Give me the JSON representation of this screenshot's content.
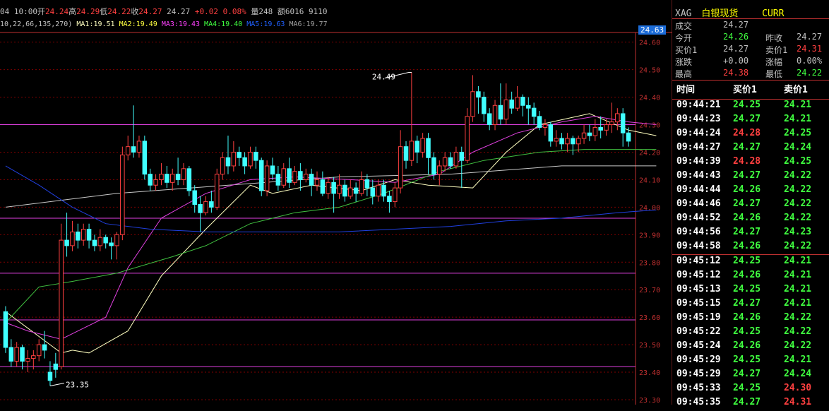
{
  "header": {
    "date_time": "04 10:00",
    "open_label": "开",
    "open": "24.24",
    "high_label": "高",
    "high": "24.29",
    "low_label": "低",
    "low": "24.22",
    "close_label": "收",
    "close": "24.27",
    "close2": "24.27",
    "change": "+0.02",
    "change_pct": "0.08%",
    "vol_label": "量",
    "vol": "248",
    "amt_label": "额",
    "amt": "6016 9110"
  },
  "ma_bar": {
    "params": "10,22,66,135,270)",
    "ma1": "MA1:19.51",
    "ma2": "MA2:19.49",
    "ma3": "MA3:19.43",
    "ma4": "MA4:19.40",
    "ma5": "MA5:19.63",
    "ma6": "MA6:19.77"
  },
  "current_price_tag": "24.63",
  "annotations": {
    "high_label": "24.49",
    "low_label": "23.35"
  },
  "panel": {
    "code": "XAG",
    "name": "白银现货",
    "tag": "CURR",
    "rows": [
      {
        "l1": "成交",
        "v1": "24.27",
        "l2": "",
        "v2": ""
      },
      {
        "l1": "今开",
        "v1": "24.26",
        "l2": "昨收",
        "v2": "24.27"
      },
      {
        "l1": "买价1",
        "v1": "24.27",
        "l2": "卖价1",
        "v2": "24.31"
      },
      {
        "l1": "涨跌",
        "v1": "+0.00",
        "l2": "涨幅",
        "v2": "0.00%"
      },
      {
        "l1": "最高",
        "v1": "24.38",
        "l2": "最低",
        "v2": "24.22"
      }
    ],
    "quote_headers": [
      "时间",
      "买价1",
      "卖价1"
    ],
    "quotes": [
      [
        "09:44:21",
        "24.25",
        "24.21"
      ],
      [
        "09:44:23",
        "24.27",
        "24.21"
      ],
      [
        "09:44:24",
        "24.28",
        "24.25"
      ],
      [
        "09:44:27",
        "24.27",
        "24.24"
      ],
      [
        "09:44:39",
        "24.28",
        "24.25"
      ],
      [
        "09:44:43",
        "24.27",
        "24.22"
      ],
      [
        "09:44:44",
        "24.26",
        "24.22"
      ],
      [
        "09:44:46",
        "24.27",
        "24.22"
      ],
      [
        "09:44:52",
        "24.26",
        "24.22"
      ],
      [
        "09:44:56",
        "24.27",
        "24.23"
      ],
      [
        "09:44:58",
        "24.26",
        "24.22"
      ],
      [
        "09:45:12",
        "24.25",
        "24.21"
      ],
      [
        "09:45:12",
        "24.26",
        "24.21"
      ],
      [
        "09:45:13",
        "24.25",
        "24.21"
      ],
      [
        "09:45:15",
        "24.27",
        "24.21"
      ],
      [
        "09:45:19",
        "24.26",
        "24.22"
      ],
      [
        "09:45:22",
        "24.25",
        "24.22"
      ],
      [
        "09:45:24",
        "24.26",
        "24.22"
      ],
      [
        "09:45:29",
        "24.25",
        "24.21"
      ],
      [
        "09:45:29",
        "24.27",
        "24.24"
      ],
      [
        "09:45:33",
        "24.25",
        "24.30"
      ],
      [
        "09:45:35",
        "24.27",
        "24.31"
      ]
    ],
    "quote_colors": [
      [
        "g",
        "g"
      ],
      [
        "g",
        "g"
      ],
      [
        "r",
        "g"
      ],
      [
        "g",
        "g"
      ],
      [
        "r",
        "g"
      ],
      [
        "g",
        "g"
      ],
      [
        "g",
        "g"
      ],
      [
        "g",
        "g"
      ],
      [
        "g",
        "g"
      ],
      [
        "g",
        "g"
      ],
      [
        "g",
        "g"
      ],
      [
        "g",
        "g"
      ],
      [
        "g",
        "g"
      ],
      [
        "g",
        "g"
      ],
      [
        "g",
        "g"
      ],
      [
        "g",
        "g"
      ],
      [
        "g",
        "g"
      ],
      [
        "g",
        "g"
      ],
      [
        "g",
        "g"
      ],
      [
        "g",
        "g"
      ],
      [
        "g",
        "r"
      ],
      [
        "g",
        "r"
      ]
    ]
  },
  "chart_data": {
    "type": "candlestick",
    "ylim": [
      23.3,
      24.63
    ],
    "y_ticks": [
      "24.60",
      "24.50",
      "24.40",
      "24.30",
      "24.20",
      "24.10",
      "24.00",
      "23.90",
      "23.80",
      "23.70",
      "23.60",
      "23.50",
      "23.40",
      "23.30"
    ],
    "hlines": [
      24.3,
      23.96,
      23.76,
      23.59,
      23.42
    ],
    "candles": [
      [
        23.62,
        23.49,
        23.64,
        23.47
      ],
      [
        23.49,
        23.44,
        23.52,
        23.42
      ],
      [
        23.44,
        23.49,
        23.51,
        23.42
      ],
      [
        23.49,
        23.44,
        23.5,
        23.41
      ],
      [
        23.44,
        23.45,
        23.48,
        23.4
      ],
      [
        23.45,
        23.46,
        23.48,
        23.41
      ],
      [
        23.46,
        23.5,
        23.52,
        23.44
      ],
      [
        23.5,
        23.48,
        23.55,
        23.45
      ],
      [
        23.4,
        23.37,
        23.44,
        23.35
      ],
      [
        23.43,
        23.41,
        23.47,
        23.38
      ],
      [
        23.42,
        23.88,
        23.94,
        23.41
      ],
      [
        23.88,
        23.86,
        23.98,
        23.82
      ],
      [
        23.86,
        23.91,
        23.95,
        23.84
      ],
      [
        23.91,
        23.88,
        23.94,
        23.85
      ],
      [
        23.88,
        23.92,
        23.94,
        23.86
      ],
      [
        23.92,
        23.88,
        23.94,
        23.85
      ],
      [
        23.88,
        23.86,
        23.9,
        23.84
      ],
      [
        23.86,
        23.89,
        23.92,
        23.84
      ],
      [
        23.89,
        23.87,
        23.9,
        23.85
      ],
      [
        23.87,
        23.86,
        23.89,
        23.81
      ],
      [
        23.86,
        23.9,
        23.91,
        23.81
      ],
      [
        23.9,
        24.19,
        24.22,
        23.88
      ],
      [
        24.19,
        24.22,
        24.26,
        24.17
      ],
      [
        24.22,
        24.2,
        24.37,
        24.18
      ],
      [
        24.2,
        24.24,
        24.26,
        24.18
      ],
      [
        24.24,
        24.12,
        24.26,
        24.1
      ],
      [
        24.12,
        24.08,
        24.14,
        24.06
      ],
      [
        24.08,
        24.1,
        24.12,
        24.06
      ],
      [
        24.1,
        24.12,
        24.16,
        24.08
      ],
      [
        24.12,
        24.09,
        24.15,
        24.07
      ],
      [
        24.09,
        24.12,
        24.14,
        24.06
      ],
      [
        24.12,
        24.1,
        24.18,
        24.08
      ],
      [
        24.1,
        24.14,
        24.16,
        24.08
      ],
      [
        24.14,
        24.06,
        24.15,
        24.04
      ],
      [
        24.06,
        24.01,
        24.08,
        23.98
      ],
      [
        24.01,
        23.98,
        24.04,
        23.91
      ],
      [
        23.98,
        24.02,
        24.04,
        23.97
      ],
      [
        24.02,
        24.0,
        24.06,
        23.98
      ],
      [
        24.0,
        24.12,
        24.14,
        23.99
      ],
      [
        24.12,
        24.18,
        24.2,
        24.1
      ],
      [
        24.18,
        24.15,
        24.26,
        24.12
      ],
      [
        24.15,
        24.2,
        24.24,
        24.13
      ],
      [
        24.2,
        24.18,
        24.22,
        24.15
      ],
      [
        24.18,
        24.15,
        24.2,
        24.12
      ],
      [
        24.15,
        24.2,
        24.22,
        24.14
      ],
      [
        24.2,
        24.17,
        24.22,
        24.14
      ],
      [
        24.17,
        24.06,
        24.18,
        24.04
      ],
      [
        24.06,
        24.15,
        24.17,
        24.04
      ],
      [
        24.15,
        24.12,
        24.18,
        24.1
      ],
      [
        24.12,
        24.08,
        24.15,
        24.06
      ],
      [
        24.08,
        24.14,
        24.16,
        24.07
      ],
      [
        24.14,
        24.09,
        24.18,
        24.07
      ],
      [
        24.09,
        24.13,
        24.15,
        24.08
      ],
      [
        24.13,
        24.1,
        24.16,
        24.06
      ],
      [
        24.1,
        24.12,
        24.14,
        24.09
      ],
      [
        24.12,
        24.08,
        24.14,
        24.04
      ],
      [
        24.08,
        24.1,
        24.13,
        24.06
      ],
      [
        24.1,
        24.05,
        24.13,
        24.04
      ],
      [
        24.05,
        24.09,
        24.11,
        24.03
      ],
      [
        24.09,
        24.05,
        24.11,
        23.98
      ],
      [
        24.05,
        24.08,
        24.12,
        24.03
      ],
      [
        24.08,
        24.04,
        24.1,
        24.02
      ],
      [
        24.04,
        24.07,
        24.1,
        24.03
      ],
      [
        24.07,
        24.05,
        24.09,
        24.02
      ],
      [
        24.05,
        24.1,
        24.13,
        24.04
      ],
      [
        24.1,
        24.07,
        24.12,
        24.04
      ],
      [
        24.07,
        24.04,
        24.1,
        24.01
      ],
      [
        24.04,
        24.08,
        24.1,
        24.02
      ],
      [
        24.08,
        24.04,
        24.1,
        24.02
      ],
      [
        24.04,
        24.02,
        24.06,
        23.98
      ],
      [
        24.02,
        24.07,
        24.09,
        24.0
      ],
      [
        24.07,
        24.22,
        24.28,
        24.05
      ],
      [
        24.22,
        24.17,
        24.24,
        24.14
      ],
      [
        24.17,
        24.24,
        24.49,
        24.15
      ],
      [
        24.24,
        24.2,
        24.26,
        24.16
      ],
      [
        24.2,
        24.25,
        24.27,
        24.18
      ],
      [
        24.25,
        24.18,
        24.27,
        24.12
      ],
      [
        24.18,
        24.12,
        24.2,
        24.1
      ],
      [
        24.12,
        24.15,
        24.17,
        24.08
      ],
      [
        24.15,
        24.18,
        24.2,
        24.13
      ],
      [
        24.18,
        24.15,
        24.2,
        24.14
      ],
      [
        24.15,
        24.2,
        24.22,
        24.14
      ],
      [
        24.2,
        24.17,
        24.22,
        24.07
      ],
      [
        24.17,
        24.33,
        24.36,
        24.16
      ],
      [
        24.33,
        24.42,
        24.48,
        24.31
      ],
      [
        24.42,
        24.4,
        24.44,
        24.34
      ],
      [
        24.4,
        24.34,
        24.42,
        24.31
      ],
      [
        24.34,
        24.3,
        24.36,
        24.28
      ],
      [
        24.3,
        24.37,
        24.39,
        24.28
      ],
      [
        24.37,
        24.32,
        24.45,
        24.3
      ],
      [
        24.32,
        24.39,
        24.45,
        24.3
      ],
      [
        24.39,
        24.36,
        24.42,
        24.34
      ],
      [
        24.36,
        24.4,
        24.44,
        24.35
      ],
      [
        24.4,
        24.37,
        24.41,
        24.33
      ],
      [
        24.37,
        24.36,
        24.4,
        24.3
      ],
      [
        24.36,
        24.33,
        24.38,
        24.3
      ],
      [
        24.33,
        24.29,
        24.35,
        24.28
      ],
      [
        24.29,
        24.3,
        24.32,
        24.26
      ],
      [
        24.3,
        24.24,
        24.31,
        24.22
      ],
      [
        24.24,
        24.25,
        24.28,
        24.22
      ],
      [
        24.25,
        24.23,
        24.27,
        24.21
      ],
      [
        24.23,
        24.25,
        24.27,
        24.2
      ],
      [
        24.25,
        24.23,
        24.26,
        24.19
      ],
      [
        24.23,
        24.25,
        24.26,
        24.2
      ],
      [
        24.25,
        24.27,
        24.3,
        24.23
      ],
      [
        24.27,
        24.26,
        24.3,
        24.24
      ],
      [
        24.26,
        24.29,
        24.32,
        24.24
      ],
      [
        24.29,
        24.28,
        24.33,
        24.25
      ],
      [
        24.28,
        24.3,
        24.32,
        24.26
      ],
      [
        24.3,
        24.31,
        24.38,
        24.27
      ],
      [
        24.31,
        24.34,
        24.36,
        24.28
      ],
      [
        24.34,
        24.27,
        24.36,
        24.22
      ],
      [
        24.27,
        24.24,
        24.29,
        24.22
      ]
    ],
    "ma": [
      {
        "name": "MA1",
        "color": "#ffffc0",
        "pts": [
          [
            23.62,
            0
          ],
          [
            23.56,
            4
          ],
          [
            23.5,
            8
          ],
          [
            23.47,
            10
          ],
          [
            23.48,
            12
          ],
          [
            23.47,
            15
          ],
          [
            23.55,
            22
          ],
          [
            23.75,
            28
          ],
          [
            23.92,
            36
          ],
          [
            24.08,
            44
          ],
          [
            24.05,
            48
          ],
          [
            24.08,
            55
          ],
          [
            24.06,
            64
          ],
          [
            24.1,
            70
          ],
          [
            24.08,
            76
          ],
          [
            24.07,
            84
          ],
          [
            24.2,
            90
          ],
          [
            24.3,
            96
          ],
          [
            24.34,
            105
          ],
          [
            24.28,
            112
          ],
          [
            24.26,
            117
          ]
        ]
      },
      {
        "name": "MA2",
        "color": "#c8c8c8",
        "pts": [
          [
            24.0,
            0
          ],
          [
            24.05,
            20
          ],
          [
            24.08,
            40
          ],
          [
            24.11,
            60
          ],
          [
            24.12,
            80
          ],
          [
            24.15,
            100
          ],
          [
            24.15,
            117
          ]
        ]
      },
      {
        "name": "MA3",
        "color": "#e040e0",
        "pts": [
          [
            23.58,
            0
          ],
          [
            23.55,
            4
          ],
          [
            23.52,
            10
          ],
          [
            23.6,
            18
          ],
          [
            23.78,
            22
          ],
          [
            23.96,
            28
          ],
          [
            24.05,
            36
          ],
          [
            24.1,
            44
          ],
          [
            24.11,
            52
          ],
          [
            24.1,
            62
          ],
          [
            24.09,
            70
          ],
          [
            24.12,
            78
          ],
          [
            24.2,
            84
          ],
          [
            24.27,
            92
          ],
          [
            24.31,
            100
          ],
          [
            24.33,
            106
          ],
          [
            24.31,
            112
          ],
          [
            24.3,
            117
          ]
        ]
      },
      {
        "name": "MA4",
        "color": "#40c040",
        "pts": [
          [
            23.58,
            0
          ],
          [
            23.71,
            6
          ],
          [
            23.73,
            12
          ],
          [
            23.76,
            20
          ],
          [
            23.82,
            30
          ],
          [
            23.86,
            36
          ],
          [
            23.94,
            44
          ],
          [
            23.98,
            52
          ],
          [
            24.0,
            60
          ],
          [
            24.05,
            68
          ],
          [
            24.13,
            78
          ],
          [
            24.17,
            86
          ],
          [
            24.2,
            96
          ],
          [
            24.21,
            104
          ],
          [
            24.21,
            110
          ],
          [
            24.21,
            117
          ]
        ]
      },
      {
        "name": "MA5",
        "color": "#2040e0",
        "pts": [
          [
            24.15,
            0
          ],
          [
            24.08,
            6
          ],
          [
            24.0,
            12
          ],
          [
            23.94,
            18
          ],
          [
            23.92,
            26
          ],
          [
            23.91,
            36
          ],
          [
            23.91,
            48
          ],
          [
            23.91,
            60
          ],
          [
            23.92,
            70
          ],
          [
            23.93,
            80
          ],
          [
            23.95,
            90
          ],
          [
            23.96,
            100
          ],
          [
            23.98,
            110
          ],
          [
            23.99,
            117
          ]
        ]
      }
    ]
  }
}
